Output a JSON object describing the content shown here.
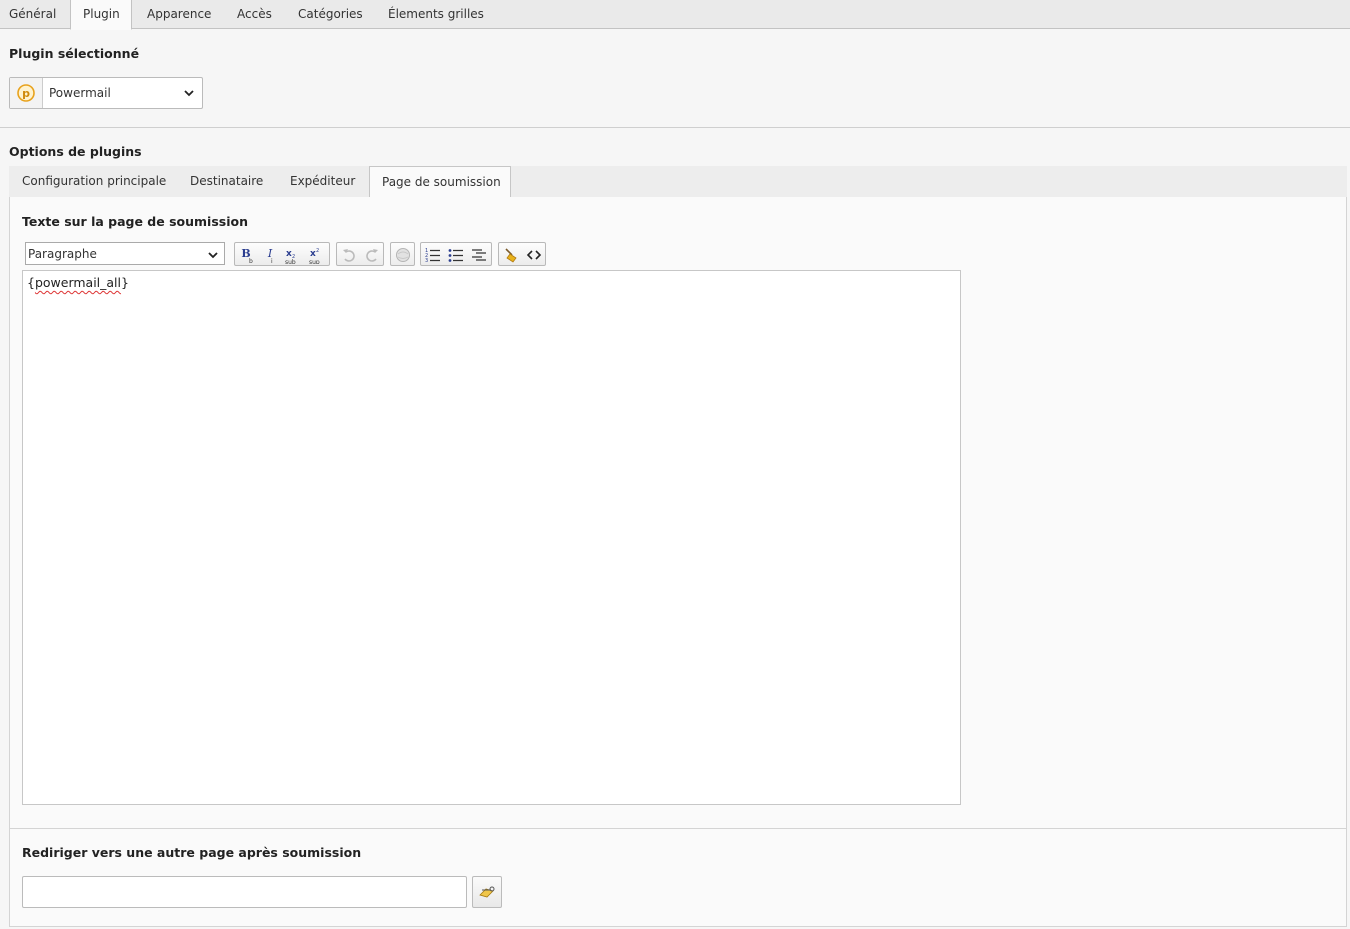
{
  "top_tabs": [
    {
      "label": "Général"
    },
    {
      "label": "Plugin"
    },
    {
      "label": "Apparence"
    },
    {
      "label": "Accès"
    },
    {
      "label": "Catégories"
    },
    {
      "label": "Élements grilles"
    }
  ],
  "active_top_tab": "Plugin",
  "plugin_section": {
    "title": "Plugin sélectionné",
    "selected_plugin": "Powermail"
  },
  "options_section": {
    "title": "Options de plugins",
    "tabs": [
      {
        "label": "Configuration principale"
      },
      {
        "label": "Destinataire"
      },
      {
        "label": "Expéditeur"
      },
      {
        "label": "Page de soumission"
      }
    ],
    "active_tab": "Page de soumission"
  },
  "submit_text": {
    "label": "Texte sur la page de soumission",
    "format_value": "Paragraphe",
    "toolbar": {
      "bold": "B",
      "italic": "I",
      "subscript": "sub",
      "superscript": "sup"
    },
    "content_open": "{",
    "content_token": "powermail_all",
    "content_close": "}"
  },
  "redirect": {
    "label": "Rediriger vers une autre page après soumission",
    "value": ""
  },
  "colors": {
    "background": "#f6f6f6",
    "tab_bar": "#eaeaea",
    "panel": "#fafafa",
    "accent_orange": "#e8a21c"
  }
}
